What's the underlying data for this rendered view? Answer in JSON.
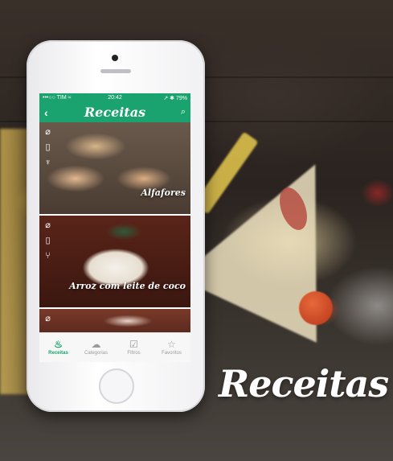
{
  "promo_title": "Receitas",
  "status_bar": {
    "carrier": "•••○○ TIM ≈",
    "time": "20:42",
    "indicators": "↗ ✱ 79%"
  },
  "navbar": {
    "title": "Receitas",
    "back_icon": "chevron-left-icon",
    "search_icon": "search-icon"
  },
  "recipes": [
    {
      "name": "Alfafores",
      "icons": [
        "gluten-free-icon",
        "dairy-free-icon",
        "dessert-icon"
      ]
    },
    {
      "name": "Arroz com leite de coco",
      "icons": [
        "gluten-free-icon",
        "dairy-free-icon",
        "main-course-icon"
      ]
    },
    {
      "name": "",
      "icons": [
        "gluten-free-icon"
      ]
    }
  ],
  "tabs": [
    {
      "label": "Receitas",
      "icon": "pot-icon",
      "active": true
    },
    {
      "label": "Categorias",
      "icon": "chef-hat-icon",
      "active": false
    },
    {
      "label": "Filtros",
      "icon": "filter-checkbox-icon",
      "active": false
    },
    {
      "label": "Favoritos",
      "icon": "star-icon",
      "active": false
    }
  ],
  "colors": {
    "brand": "#1aa36e"
  }
}
